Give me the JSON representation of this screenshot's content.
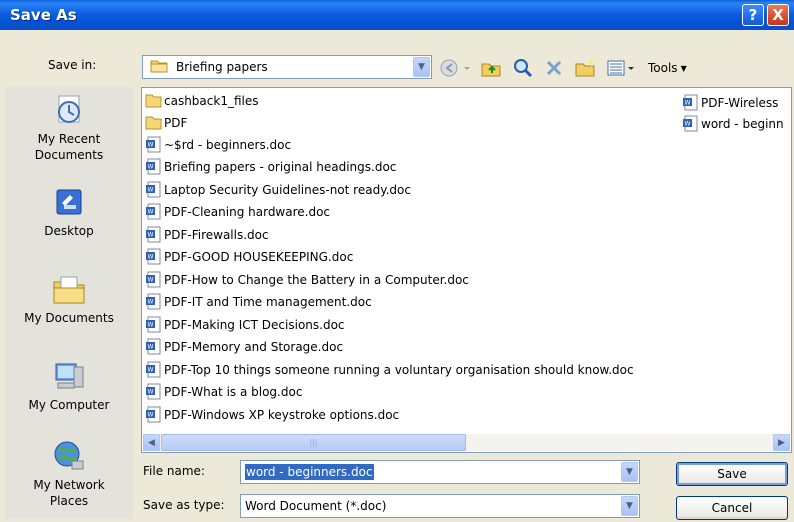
{
  "dialog": {
    "title": "Save As",
    "help_label": "?",
    "close_label": "X"
  },
  "savein": {
    "label": "Save in:",
    "value": "Briefing papers"
  },
  "toolbar": {
    "tools_label": "Tools"
  },
  "places": [
    {
      "label_lines": [
        "My Recent",
        "Documents"
      ],
      "icon": "recent-documents-icon"
    },
    {
      "label_lines": [
        "Desktop"
      ],
      "icon": "desktop-icon"
    },
    {
      "label_lines": [
        "My Documents"
      ],
      "icon": "my-documents-icon"
    },
    {
      "label_lines": [
        "My Computer"
      ],
      "icon": "my-computer-icon"
    },
    {
      "label_lines": [
        "My Network",
        "Places"
      ],
      "icon": "network-places-icon"
    }
  ],
  "files": {
    "column1": [
      {
        "name": "cashback1_files",
        "type": "folder"
      },
      {
        "name": "PDF",
        "type": "folder"
      },
      {
        "name": "~$rd - beginners.doc",
        "type": "doc"
      },
      {
        "name": "Briefing papers - original headings.doc",
        "type": "doc"
      },
      {
        "name": "Laptop Security Guidelines-not ready.doc",
        "type": "doc"
      },
      {
        "name": "PDF-Cleaning hardware.doc",
        "type": "doc"
      },
      {
        "name": "PDF-Firewalls.doc",
        "type": "doc"
      },
      {
        "name": "PDF-GOOD HOUSEKEEPING.doc",
        "type": "doc"
      },
      {
        "name": "PDF-How to Change the Battery in a Computer.doc",
        "type": "doc"
      },
      {
        "name": "PDF-IT and Time management.doc",
        "type": "doc"
      },
      {
        "name": "PDF-Making ICT Decisions.doc",
        "type": "doc"
      },
      {
        "name": "PDF-Memory and Storage.doc",
        "type": "doc"
      },
      {
        "name": "PDF-Top 10 things someone running a voluntary organisation should know.doc",
        "type": "doc"
      },
      {
        "name": "PDF-What is a blog.doc",
        "type": "doc"
      },
      {
        "name": "PDF-Windows XP keystroke options.doc",
        "type": "doc"
      }
    ],
    "column2": [
      {
        "name": "PDF-Wireless",
        "type": "doc"
      },
      {
        "name": "word - beginn",
        "type": "doc"
      }
    ]
  },
  "filename": {
    "label": "File name:",
    "value": "word - beginners.doc"
  },
  "savetype": {
    "label": "Save as type:",
    "value": "Word Document (*.doc)"
  },
  "buttons": {
    "save": "Save",
    "cancel": "Cancel"
  },
  "colors": {
    "titlebar": "#0a5fd8",
    "selection": "#316ac5",
    "dialog_bg": "#ece9d8"
  }
}
